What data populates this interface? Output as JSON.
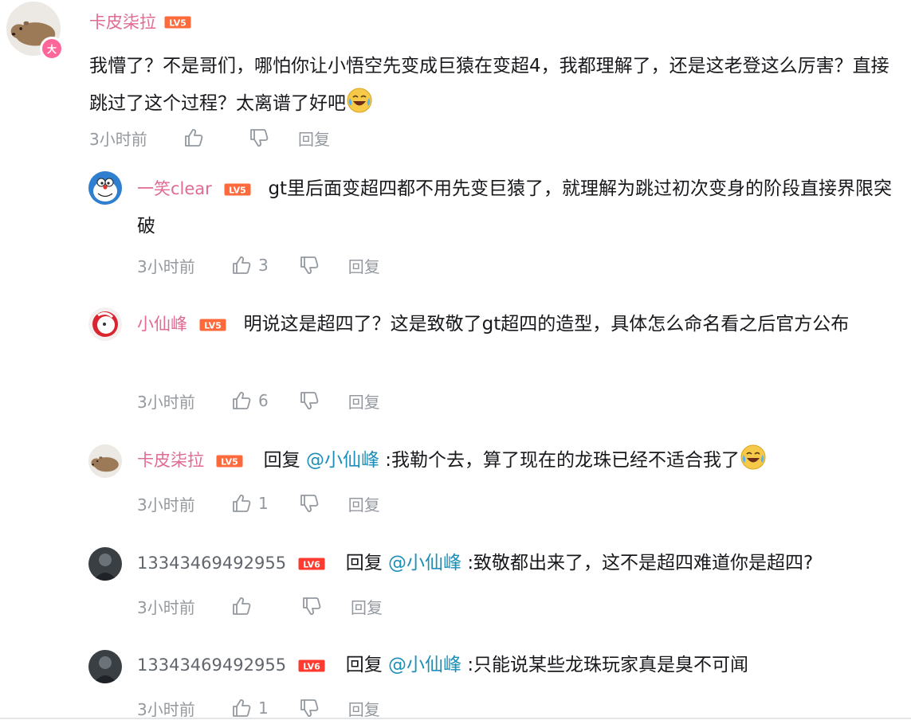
{
  "main_comment": {
    "username": "卡皮柒拉",
    "level": "LV5",
    "text": "我懵了？不是哥们，哪怕你让小悟空先变成巨猿在变超4，我都理解了，还是这老登这么厉害？直接跳过了这个过程？太离谱了好吧",
    "emoji": "crying-laughing-emoji",
    "badge": "大",
    "time": "3小时前",
    "likes": "",
    "reply_label": "回复"
  },
  "replies": [
    {
      "username": "一笑clear",
      "level": "LV5",
      "text": "gt里后面变超四都不用先变巨猿了，就理解为跳过初次变身的阶段直接界限突破",
      "time": "3小时前",
      "likes": "3",
      "reply_label": "回复"
    },
    {
      "username": "小仙峰",
      "level": "LV5",
      "text": "明说这是超四了？这是致敬了gt超四的造型，具体怎么命名看之后官方公布",
      "time": "3小时前",
      "likes": "6",
      "reply_label": "回复"
    },
    {
      "username": "卡皮柒拉",
      "level": "LV5",
      "reply_prefix": "回复",
      "mention": "@小仙峰",
      "text": ":我勒个去，算了现在的龙珠已经不适合我了",
      "emoji": "crying-laughing-emoji",
      "time": "3小时前",
      "likes": "1",
      "reply_label": "回复"
    },
    {
      "username": "13343469492955",
      "level": "LV6",
      "reply_prefix": "回复",
      "mention": "@小仙峰",
      "text": ":致敬都出来了，这不是超四难道你是超四?",
      "time": "3小时前",
      "likes": "",
      "reply_label": "回复"
    },
    {
      "username": "13343469492955",
      "level": "LV6",
      "reply_prefix": "回复",
      "mention": "@小仙峰",
      "text": ":只能说某些龙珠玩家真是臭不可闻",
      "time": "3小时前",
      "likes": "1",
      "reply_label": "回复"
    }
  ],
  "colors": {
    "username_pink": "#e06b93",
    "username_gray": "#61666d",
    "mention_blue": "#1d8fb8",
    "meta_gray": "#9499a0",
    "level_orange": "#ff6a3d",
    "level_red": "#ff3b30"
  }
}
